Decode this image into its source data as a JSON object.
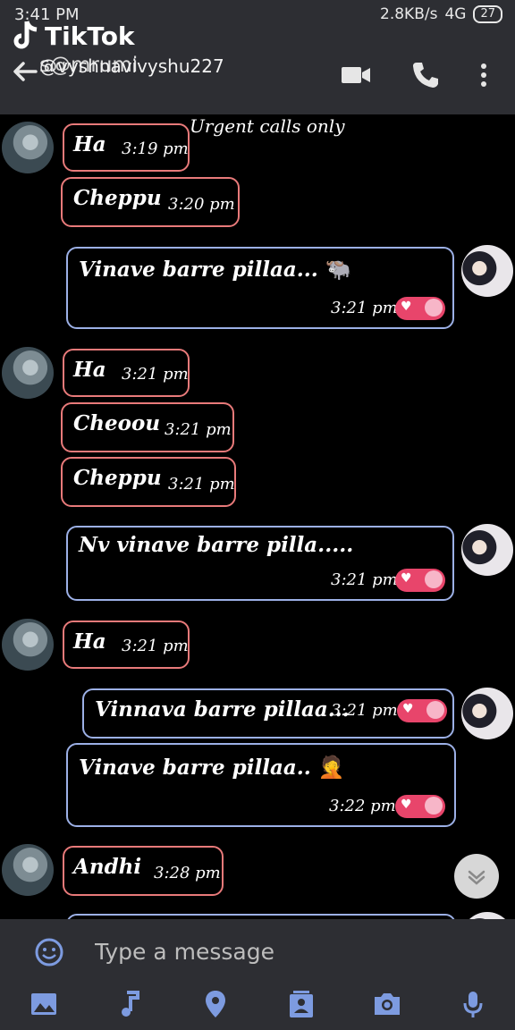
{
  "status": {
    "time": "3:41 PM",
    "network": "2.8KB/s",
    "signal": "4G",
    "battery": "27"
  },
  "overlay": {
    "app_name": "TikTok",
    "username": "@vyshnavivyshu227",
    "caption": "Urgent calls only"
  },
  "header": {
    "contact_name": "s@mrumi"
  },
  "messages": [
    {
      "dir": "in",
      "text": "Ha",
      "time": "3:19 pm"
    },
    {
      "dir": "in",
      "text": "Cheppu",
      "time": "3:20 pm"
    },
    {
      "dir": "out",
      "text": "Vinave barre pillaa...",
      "emoji": "🐃",
      "time": "3:21 pm"
    },
    {
      "dir": "in",
      "text": "Ha",
      "time": "3:21 pm"
    },
    {
      "dir": "in",
      "text": "Cheoou",
      "time": "3:21 pm"
    },
    {
      "dir": "in",
      "text": "Cheppu",
      "time": "3:21 pm"
    },
    {
      "dir": "out",
      "text": "Nv vinave barre pilla.....",
      "time": "3:21 pm"
    },
    {
      "dir": "in",
      "text": "Ha",
      "time": "3:21 pm"
    },
    {
      "dir": "out",
      "text": "Vinnava barre pillaa...",
      "time": "3:21 pm"
    },
    {
      "dir": "out",
      "text": "Vinave barre pillaa..",
      "emoji": "🤦",
      "time": "3:22 pm"
    },
    {
      "dir": "in",
      "text": "Andhi",
      "time": "3:28 pm"
    }
  ],
  "composer": {
    "placeholder": "Type a message"
  },
  "icons": [
    "back-arrow-icon",
    "video-call-icon",
    "phone-icon",
    "more-icon",
    "emoji-icon",
    "image-icon",
    "music-icon",
    "location-icon",
    "contact-icon",
    "camera-icon",
    "mic-icon",
    "chevron-down-icon"
  ],
  "colors": {
    "incoming_border": "#e87a7a",
    "outgoing_border": "#9cb0e6",
    "bar_bg": "#2d2e33",
    "icon_accent": "#7d9be0",
    "tick_pink": "#e8456b"
  }
}
